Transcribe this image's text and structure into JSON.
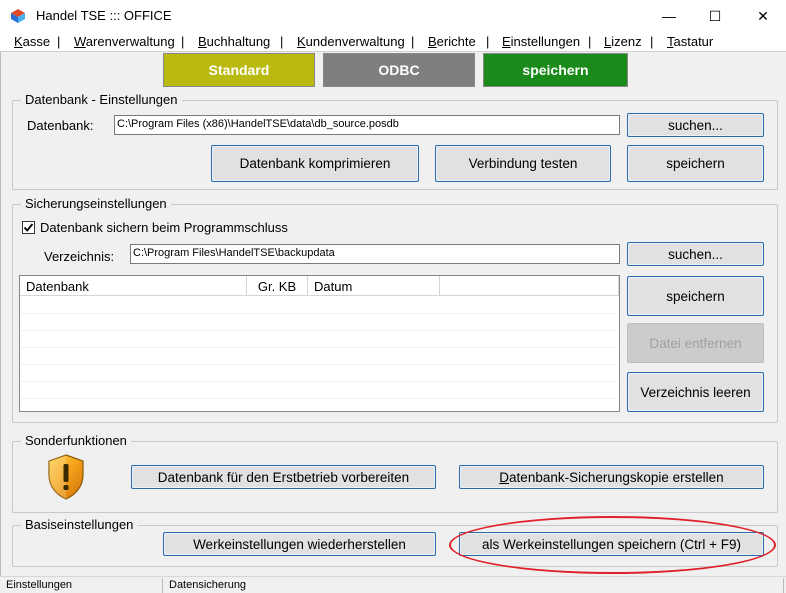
{
  "window": {
    "title": "Handel TSE ::: OFFICE",
    "minimize_glyph": "—",
    "maximize_glyph": "☐",
    "close_glyph": "✕"
  },
  "menu": [
    {
      "label": "Kasse",
      "accel": "K"
    },
    {
      "label": "Warenverwaltung",
      "accel": "W"
    },
    {
      "label": "Buchhaltung",
      "accel": "B"
    },
    {
      "label": "Kundenverwaltung",
      "accel": "K"
    },
    {
      "label": "Berichte",
      "accel": "B"
    },
    {
      "label": "Einstellungen",
      "accel": "E"
    },
    {
      "label": "Lizenz",
      "accel": "L"
    },
    {
      "label": "Tastatur",
      "accel": "T"
    }
  ],
  "menu_separator": "|",
  "top_buttons": {
    "standard": "Standard",
    "odbc": "ODBC",
    "save": "speichern"
  },
  "colors": {
    "standard_bg": "#b9b90f",
    "odbc_bg": "#7f7f7f",
    "save_bg": "#1a8a1a",
    "highlight": "#e0202a"
  },
  "db_settings": {
    "group_title": "Datenbank - Einstellungen",
    "db_label": "Datenbank:",
    "db_path": "C:\\Program Files (x86)\\HandelTSE\\data\\db_source.posdb",
    "search_btn": "suchen...",
    "compress_btn": "Datenbank komprimieren",
    "test_btn": "Verbindung testen",
    "save_btn": "speichern"
  },
  "backup_settings": {
    "group_title": "Sicherungseinstellungen",
    "checkbox_label": "Datenbank sichern beim Programmschluss",
    "checkbox_checked": true,
    "dir_label": "Verzeichnis:",
    "dir_path": "C:\\Program Files\\HandelTSE\\backupdata",
    "search_btn": "suchen...",
    "list_columns": [
      "Datenbank",
      "Gr. KB",
      "Datum",
      ""
    ],
    "save_btn": "speichern",
    "remove_btn": "Datei  entfernen",
    "clear_btn": "Verzeichnis leeren"
  },
  "special": {
    "group_title": "Sonderfunktionen",
    "icon": "shield-warning-icon",
    "prepare_btn": "Datenbank für den Erstbetrieb vorbereiten",
    "backup_copy_btn": "Datenbank-Sicherungskopie erstellen"
  },
  "basic": {
    "group_title": "Basiseinstellungen",
    "restore_btn": "Werkeinstellungen wiederherstellen",
    "save_factory_btn": "als Werkeinstellungen speichern (Ctrl + F9)"
  },
  "status": {
    "panel1": "Einstellungen",
    "panel2": "Datensicherung"
  }
}
